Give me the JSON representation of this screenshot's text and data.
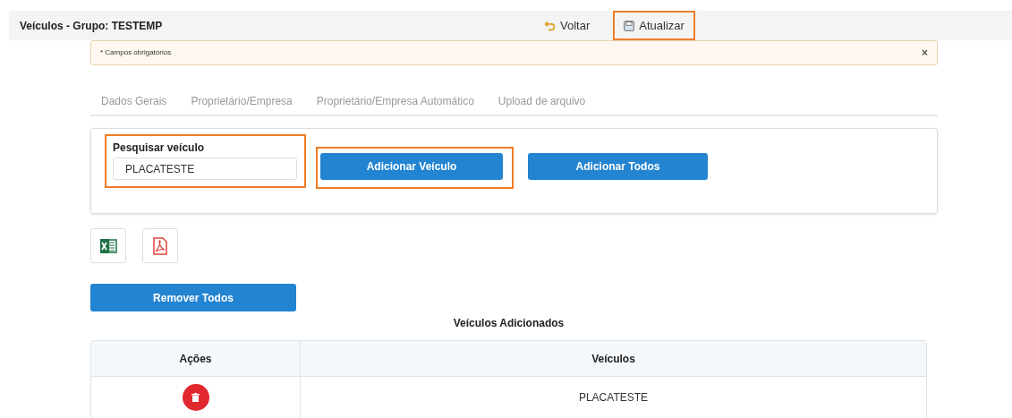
{
  "header": {
    "title": "Veículos - Grupo: TESTEMP",
    "actions": [
      {
        "kind": "back",
        "label": "Voltar",
        "highlighted": false
      },
      {
        "kind": "save",
        "label": "Atualizar",
        "highlighted": true
      }
    ]
  },
  "alert": {
    "text": "* Campos obrigatórios",
    "close": "×"
  },
  "tabs": [
    {
      "label": "Dados Gerais",
      "selected": false
    },
    {
      "label": "Proprietário/Empresa",
      "selected": false
    },
    {
      "label": "Proprietário/Empresa Automático",
      "selected": false
    },
    {
      "label": "Upload de arquivo",
      "selected": false
    }
  ],
  "search": {
    "label": "Pesquisar veículo",
    "value": "PLACATESTE",
    "highlighted": true
  },
  "add_buttons": [
    {
      "label": "Adicionar Veículo",
      "highlighted": true
    },
    {
      "label": "Adicionar Todos",
      "highlighted": false
    }
  ],
  "export_buttons": [
    {
      "kind": "excel"
    },
    {
      "kind": "pdf"
    }
  ],
  "remove_all": "Remover Todos",
  "table": {
    "title": "Veículos Adicionados",
    "columns": [
      "Ações",
      "Veículos"
    ],
    "rows": [
      {
        "vehicle": "PLACATESTE"
      }
    ]
  }
}
